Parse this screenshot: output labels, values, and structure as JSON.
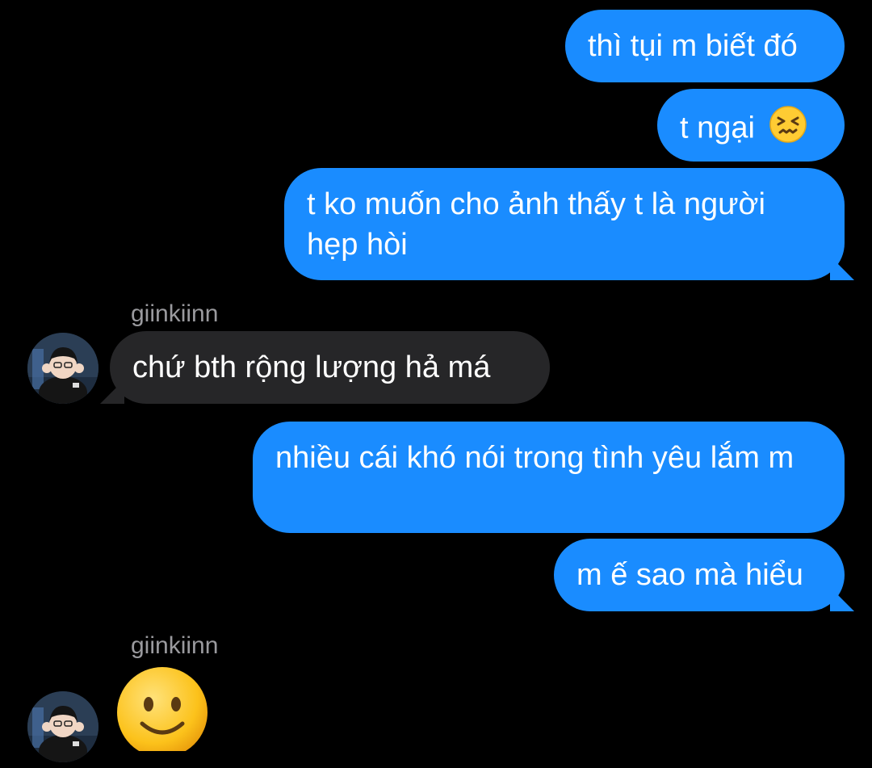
{
  "conversation": {
    "messages": [
      {
        "side": "sent",
        "text": "thì tụi m biết đó"
      },
      {
        "side": "sent",
        "text": "t ngại",
        "emoji": "confounded-face-emoji"
      },
      {
        "side": "sent",
        "text": "t ko muốn cho ảnh thấy t là người hẹp hòi"
      },
      {
        "side": "received",
        "sender": "giinkiinn",
        "text": "chứ bth rộng lượng hả má"
      },
      {
        "side": "sent",
        "text": "nhiều cái khó nói trong tình yêu lắm m"
      },
      {
        "side": "sent",
        "text": "m ế sao mà hiểu"
      },
      {
        "side": "received",
        "sender": "giinkiinn",
        "emoji": "slightly-smiling-face-emoji"
      }
    ]
  },
  "colors": {
    "background": "#000000",
    "sent_bubble": "#1a8cff",
    "received_bubble": "#262628",
    "sender_name": "#9a9a9e"
  }
}
